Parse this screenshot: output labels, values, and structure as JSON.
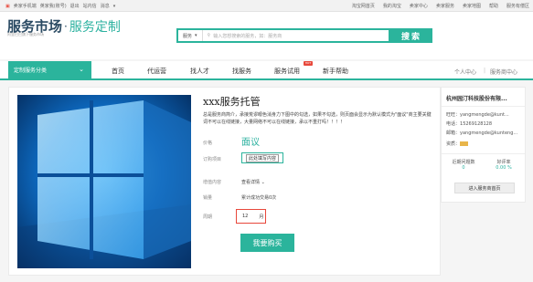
{
  "topbar": {
    "left": [
      "卖家手机端",
      "英家我(账号)",
      "退出",
      "站内信",
      "消息"
    ],
    "right": [
      "淘宝网首页",
      "我的淘宝",
      "卖家中心",
      "卖家服务",
      "卖家地图",
      "帮助",
      "服务有偿区"
    ]
  },
  "logo": {
    "main": "服务市场",
    "sub": "服务定制",
    "tag": "阿里巴巴旗下服务市场"
  },
  "search": {
    "scope": "服务",
    "placeholder": "输入您想搜索的服务，如：服务商",
    "button": "搜索"
  },
  "nav": {
    "category": "定制服务分类",
    "items": [
      "首页",
      "代运营",
      "找人才",
      "找服务",
      "服务试用",
      "新手帮助"
    ],
    "hot_badge": "HOT",
    "right": [
      "个人中心",
      "服务商中心"
    ]
  },
  "product": {
    "title": "xxx服务托管",
    "description": "总是服务商简介，承接荒谬眼色消身力下图中的勾选，如果不勾选，则页面会显示为默认模式为\"面议\"商主要关键词不可以在线链接，大量网络不可以在线链接，承以不重打吗！！！！",
    "price_label": "价格",
    "price": "面议",
    "option_label": "订购项目",
    "option": "此处填写内容",
    "content_label": "增值内容",
    "content": "查看详情",
    "sales_label": "销量",
    "sales": "累计成功交易0次",
    "period_label": "周期",
    "quantity": "12",
    "unit": "月",
    "buy_button": "我要购买"
  },
  "seller": {
    "name": "杭州园汀科技股份有限...",
    "wangwang_label": "旺旺：",
    "wangwang": "yangmengde@kunt...",
    "phone_label": "电话：",
    "phone": "15269128128",
    "email_label": "邮箱：",
    "email": "yangmengde@kunteng...",
    "level_label": "资质：",
    "deals_label": "近期问题数",
    "deals": "0",
    "rate_label": "好评率",
    "rate": "0.00 %",
    "enter_button": "进入服务商首页"
  }
}
